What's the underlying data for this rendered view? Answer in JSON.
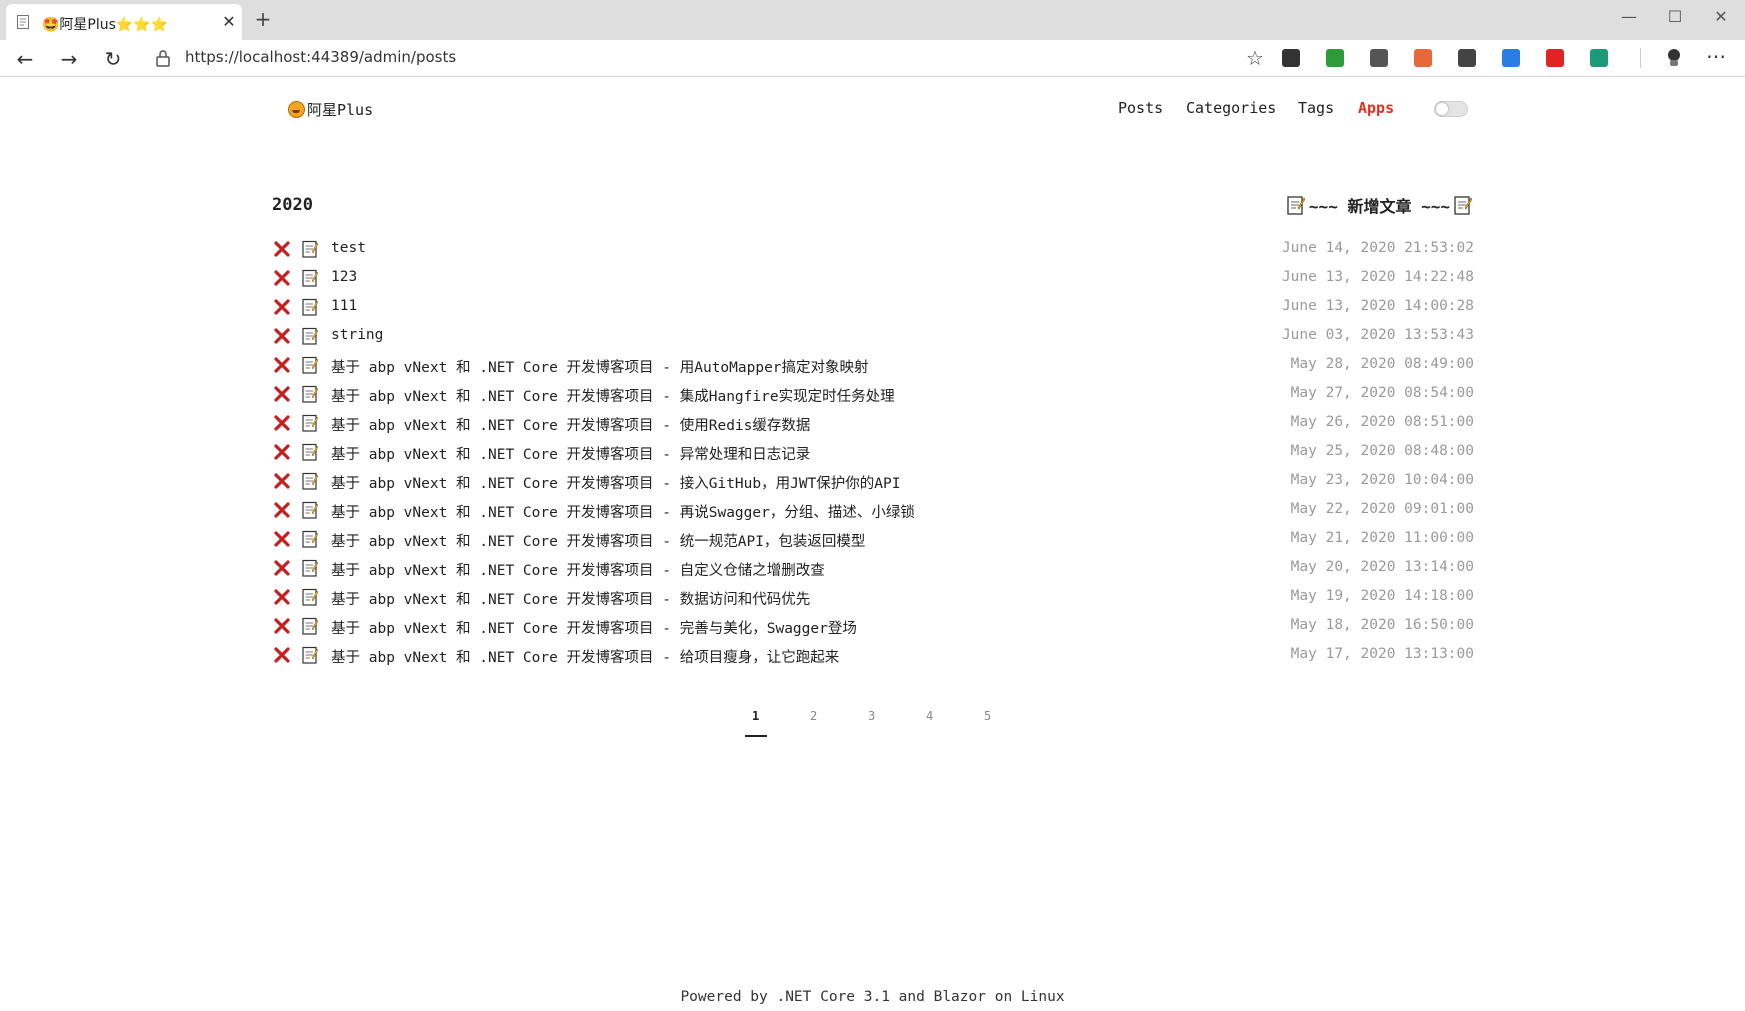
{
  "browser": {
    "tab_title": "🤩阿星Plus⭐⭐⭐",
    "url": "https://localhost:44389/admin/posts",
    "minimize_icon": "minimize-icon",
    "maximize_icon": "maximize-icon",
    "close_icon": "close-icon",
    "extensions": [
      {
        "name": "qr-code-extension-icon",
        "label": "",
        "color": "#333333"
      },
      {
        "name": "green-extension-icon",
        "label": "",
        "color": "#2e9b3a"
      },
      {
        "name": "git-zip-extension-icon",
        "label": "",
        "color": "#555555"
      },
      {
        "name": "orange-extension-icon",
        "label": "",
        "color": "#e8683a"
      },
      {
        "name": "x-extension-icon",
        "label": "",
        "color": "#444444"
      },
      {
        "name": "blue-extension-icon",
        "label": "",
        "color": "#2a7de1"
      },
      {
        "name": "fe-extension-icon",
        "label": "",
        "color": "#e02424"
      },
      {
        "name": "translate-on-extension-icon",
        "label": "",
        "color": "#1e9a7a"
      }
    ]
  },
  "header": {
    "brand": "阿星Plus",
    "nav": [
      {
        "label": "Posts",
        "active": false
      },
      {
        "label": "Categories",
        "active": false
      },
      {
        "label": "Tags",
        "active": false
      },
      {
        "label": "Apps",
        "active": true
      }
    ],
    "accent_color": "#e62e1b"
  },
  "main": {
    "year": "2020",
    "new_post_label": "~~~ 新增文章 ~~~",
    "posts": [
      {
        "title": "test",
        "date": "June 14, 2020 21:53:02"
      },
      {
        "title": "123",
        "date": "June 13, 2020 14:22:48"
      },
      {
        "title": "111",
        "date": "June 13, 2020 14:00:28"
      },
      {
        "title": "string",
        "date": "June 03, 2020 13:53:43"
      },
      {
        "title": "基于 abp vNext 和 .NET Core 开发博客项目 - 用AutoMapper搞定对象映射",
        "date": "May 28, 2020 08:49:00"
      },
      {
        "title": "基于 abp vNext 和 .NET Core 开发博客项目 - 集成Hangfire实现定时任务处理",
        "date": "May 27, 2020 08:54:00"
      },
      {
        "title": "基于 abp vNext 和 .NET Core 开发博客项目 - 使用Redis缓存数据",
        "date": "May 26, 2020 08:51:00"
      },
      {
        "title": "基于 abp vNext 和 .NET Core 开发博客项目 - 异常处理和日志记录",
        "date": "May 25, 2020 08:48:00"
      },
      {
        "title": "基于 abp vNext 和 .NET Core 开发博客项目 - 接入GitHub，用JWT保护你的API",
        "date": "May 23, 2020 10:04:00"
      },
      {
        "title": "基于 abp vNext 和 .NET Core 开发博客项目 - 再说Swagger，分组、描述、小绿锁",
        "date": "May 22, 2020 09:01:00"
      },
      {
        "title": "基于 abp vNext 和 .NET Core 开发博客项目 - 统一规范API，包装返回模型",
        "date": "May 21, 2020 11:00:00"
      },
      {
        "title": "基于 abp vNext 和 .NET Core 开发博客项目 - 自定义仓储之增删改查",
        "date": "May 20, 2020 13:14:00"
      },
      {
        "title": "基于 abp vNext 和 .NET Core 开发博客项目 - 数据访问和代码优先",
        "date": "May 19, 2020 14:18:00"
      },
      {
        "title": "基于 abp vNext 和 .NET Core 开发博客项目 - 完善与美化，Swagger登场",
        "date": "May 18, 2020 16:50:00"
      },
      {
        "title": "基于 abp vNext 和 .NET Core 开发博客项目 - 给项目瘦身，让它跑起来",
        "date": "May 17, 2020 13:13:00"
      }
    ]
  },
  "pagination": {
    "pages": [
      "1",
      "2",
      "3",
      "4",
      "5"
    ],
    "current": "1"
  },
  "footer": {
    "text": "Powered by .NET Core 3.1 and Blazor on Linux"
  }
}
